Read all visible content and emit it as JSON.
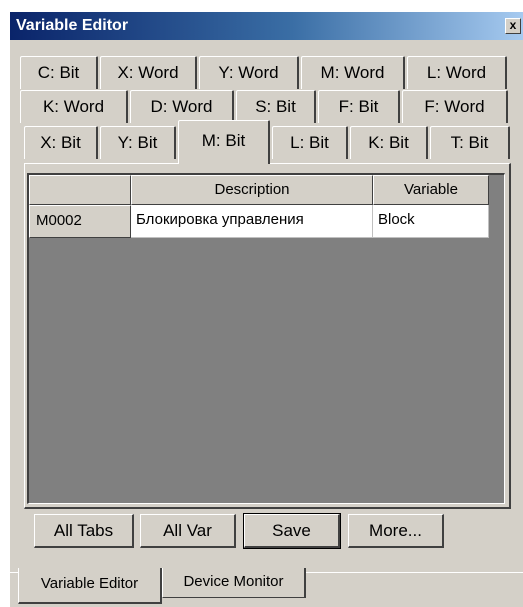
{
  "window": {
    "title": "Variable Editor",
    "close_label": "x"
  },
  "tabs": {
    "row1": [
      "C: Bit",
      "X: Word",
      "Y: Word",
      "M: Word",
      "L: Word"
    ],
    "row2": [
      "K: Word",
      "D: Word",
      "S: Bit",
      "F: Bit",
      "F: Word"
    ],
    "row3": [
      "X: Bit",
      "Y: Bit",
      "M: Bit",
      "L: Bit",
      "K: Bit",
      "T: Bit"
    ],
    "active": "M: Bit"
  },
  "grid": {
    "columns": [
      "",
      "Description",
      "Variable"
    ],
    "rows": [
      {
        "id": "M0002",
        "description": "Блокировка управления",
        "variable": "Block"
      }
    ]
  },
  "buttons": {
    "all_tabs": "All Tabs",
    "all_var": "All Var",
    "save": "Save",
    "more": "More..."
  },
  "bottom_tabs": [
    "Variable Editor",
    "Device Monitor"
  ],
  "colors": {
    "window_bg": "#d4d0c8",
    "title_start": "#0a246a",
    "title_end": "#a6caf0",
    "grid_bg": "#808080"
  }
}
